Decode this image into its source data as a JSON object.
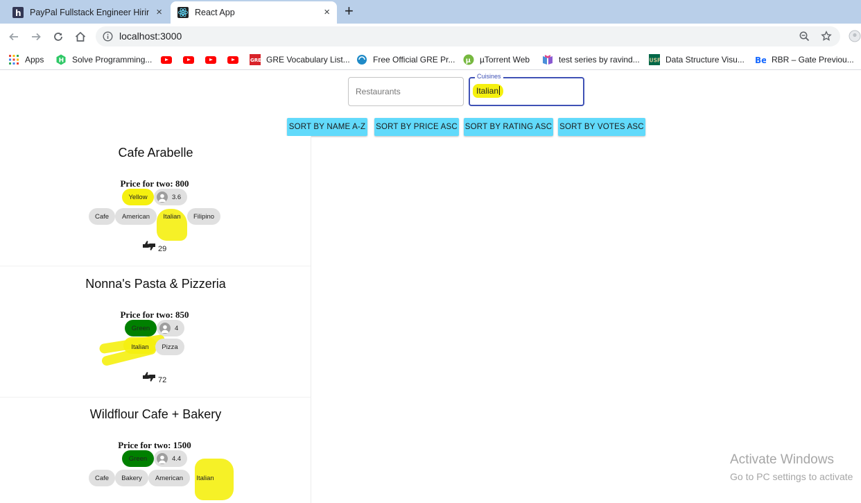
{
  "browser": {
    "tabs": [
      {
        "title": "PayPal Fullstack Engineer Hiring C",
        "favicon": "hackerearth-logo",
        "close": "×"
      },
      {
        "title": "React App",
        "favicon": "react-logo",
        "close": "×"
      }
    ],
    "new_tab": "+",
    "address": "localhost:3000",
    "bookmarks": [
      {
        "label": "Apps",
        "icon": "apps-grid-icon"
      },
      {
        "label": "Solve Programming...",
        "icon": "hackerrank-icon"
      },
      {
        "label": "",
        "icon": "youtube-icon"
      },
      {
        "label": "",
        "icon": "youtube-icon"
      },
      {
        "label": "",
        "icon": "youtube-icon"
      },
      {
        "label": "",
        "icon": "youtube-icon"
      },
      {
        "label": "GRE Vocabulary List...",
        "icon": "gre-icon"
      },
      {
        "label": "Free Official GRE Pr...",
        "icon": "ets-icon"
      },
      {
        "label": "µTorrent Web",
        "icon": "utorrent-icon"
      },
      {
        "label": "test series by ravind...",
        "icon": "test-series-icon"
      },
      {
        "label": "Data Structure Visu...",
        "icon": "usf-icon"
      },
      {
        "label": "RBR – Gate Previou...",
        "icon": "behance-icon"
      }
    ]
  },
  "search": {
    "restaurants_placeholder": "Restaurants",
    "cuisines_label": "Cuisines",
    "cuisines_value": "Italian"
  },
  "sort_buttons": [
    "SORT BY NAME A-Z",
    "SORT BY PRICE ASC",
    "SORT BY RATING ASC",
    "SORT BY VOTES ASC"
  ],
  "restaurants": [
    {
      "name": "Cafe Arabelle",
      "price": "Price for two: 800",
      "rating_color_text": "Yellow",
      "rating_color": "#f5f00f",
      "rating": "3.6",
      "cuisines": [
        "Cafe",
        "American",
        "Italian",
        "Filipino"
      ],
      "votes": "29"
    },
    {
      "name": "Nonna's Pasta & Pizzeria",
      "price": "Price for two: 850",
      "rating_color_text": "Green",
      "rating_color": "#008000",
      "rating": "4",
      "cuisines": [
        "Italian",
        "Pizza"
      ],
      "votes": "72"
    },
    {
      "name": "Wildflour Cafe + Bakery",
      "price": "Price for two: 1500",
      "rating_color_text": "Green",
      "rating_color": "#008000",
      "rating": "4.4",
      "cuisines": [
        "Cafe",
        "Bakery",
        "American",
        "Italian"
      ],
      "votes": ""
    }
  ],
  "watermark": {
    "line1": "Activate Windows",
    "line2": "Go to PC settings to activate"
  }
}
